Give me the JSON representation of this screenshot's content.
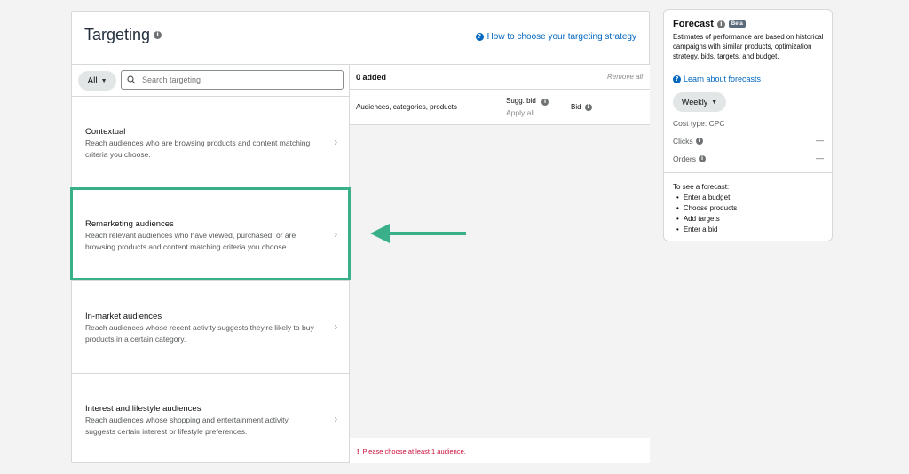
{
  "header": {
    "title": "Targeting",
    "help_link": "How to choose your targeting strategy"
  },
  "filter": {
    "selected": "All",
    "search_placeholder": "Search targeting"
  },
  "options": [
    {
      "title": "Contextual",
      "desc": "Reach audiences who are browsing products and content matching criteria you choose."
    },
    {
      "title": "Remarketing audiences",
      "desc": "Reach relevant audiences who have viewed, purchased, or are browsing products and content matching criteria you choose."
    },
    {
      "title": "In-market audiences",
      "desc": "Reach audiences whose recent activity suggests they're likely to buy products in a certain category."
    },
    {
      "title": "Interest and lifestyle audiences",
      "desc": "Reach audiences whose shopping and entertainment activity suggests certain interest or lifestyle preferences."
    }
  ],
  "added": {
    "count_label": "0 added",
    "remove_all": "Remove all",
    "col_audiences": "Audiences, categories, products",
    "col_sugg_bid": "Sugg. bid",
    "apply_all": "Apply all",
    "col_bid": "Bid",
    "warning": "Please choose at least 1 audience."
  },
  "forecast": {
    "title": "Forecast",
    "badge": "Beta",
    "description": "Estimates of performance are based on historical campaigns with similar products, optimization strategy, bids, targets, and budget.",
    "learn_link": "Learn about forecasts",
    "period": "Weekly",
    "cost_type": "Cost type: CPC",
    "clicks_label": "Clicks",
    "clicks_value": "—",
    "orders_label": "Orders",
    "orders_value": "—",
    "to_see": "To see a forecast:",
    "steps": [
      "Enter a budget",
      "Choose products",
      "Add targets",
      "Enter a bid"
    ]
  },
  "colors": {
    "highlight": "#3ab08a",
    "link": "#0066c0",
    "error": "#cc0c39"
  }
}
